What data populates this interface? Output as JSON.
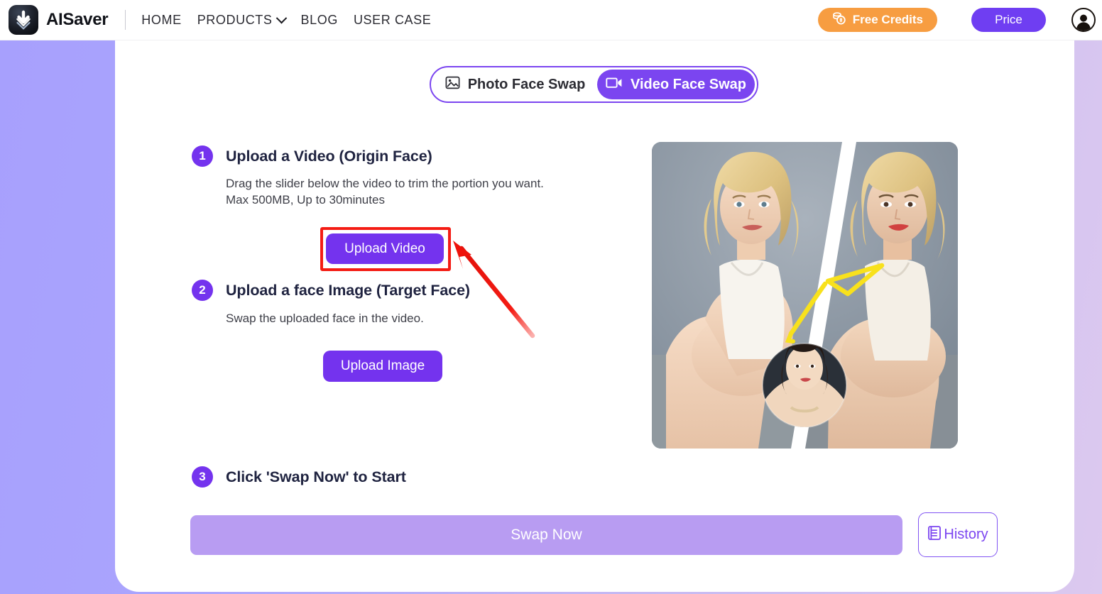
{
  "header": {
    "logo_icon": "download-arrow-logo-icon",
    "brand": "AISaver",
    "nav": [
      {
        "label": "HOME",
        "icon": null
      },
      {
        "label": "PRODUCTS",
        "icon": "chevron-down-icon"
      },
      {
        "label": "BLOG",
        "icon": null
      },
      {
        "label": "USER CASE",
        "icon": null
      }
    ],
    "free_credits_label": "Free Credits",
    "free_credits_icon": "coins-icon",
    "free_credits_color": "#F79D41",
    "price_label": "Price",
    "price_color": "#6F3EF2",
    "avatar_icon": "user-avatar-icon"
  },
  "tabs": [
    {
      "label": "Photo Face Swap",
      "icon": "image-icon",
      "active": false
    },
    {
      "label": "Video Face Swap",
      "icon": "video-camera-icon",
      "active": true
    }
  ],
  "steps": [
    {
      "number": "1",
      "title": "Upload a Video (Origin Face)",
      "desc_line1": "Drag the slider below the video to trim the portion you want.",
      "desc_line2": "Max 500MB, Up to 30minutes",
      "button": "Upload Video"
    },
    {
      "number": "2",
      "title": "Upload a face Image (Target Face)",
      "desc_line1": "Swap the uploaded face in the video.",
      "desc_line2": "",
      "button": "Upload Image"
    },
    {
      "number": "3",
      "title": "Click 'Swap Now' to Start",
      "desc_line1": "",
      "desc_line2": "",
      "button": ""
    }
  ],
  "footer": {
    "swap_now_label": "Swap Now",
    "history_label": "History",
    "history_icon": "document-list-icon"
  },
  "preview": {
    "alt": "before-after-face-swap-preview",
    "thumb_icon": "target-face-thumbnail"
  },
  "annotation": {
    "highlight_target": "Upload Video",
    "box_color": "#F41C14",
    "arrow_color": "#F41C14"
  },
  "theme": {
    "accent_purple": "#7433EE",
    "accent_purple_light": "#B89CF2",
    "background_left": "#A7A0FD",
    "background_right": "#DCC9EF",
    "card_background": "#FFFFFF"
  }
}
